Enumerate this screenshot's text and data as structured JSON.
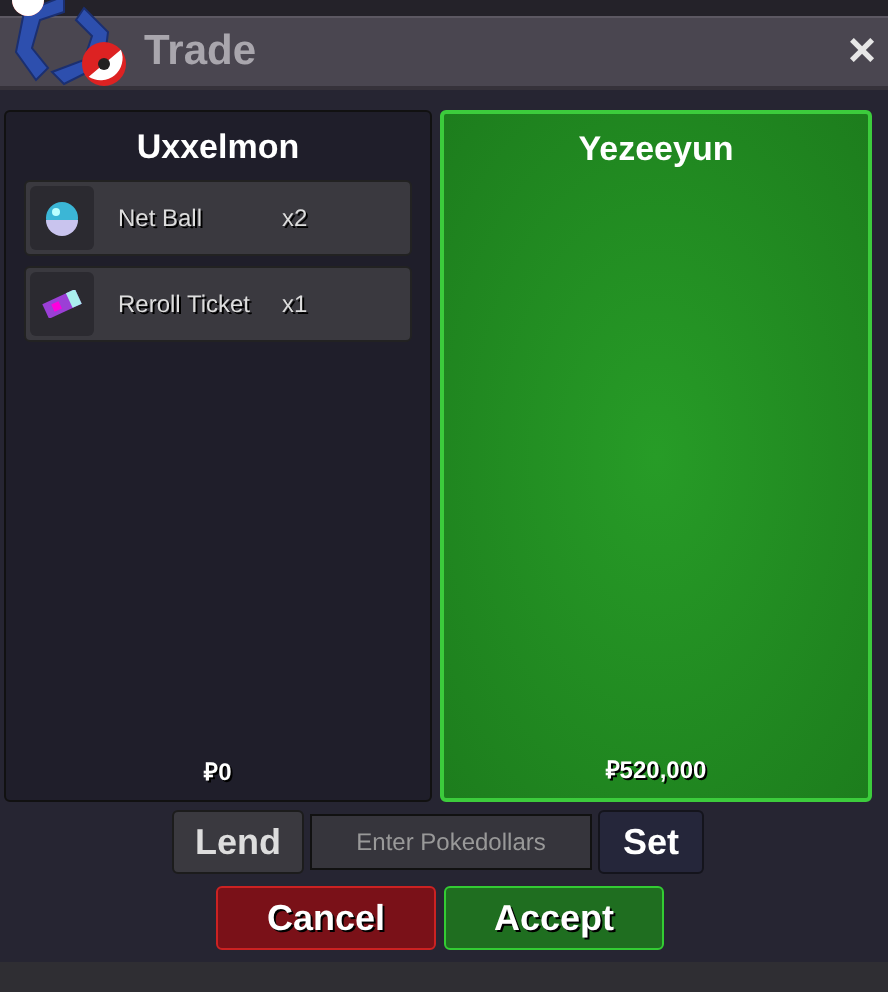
{
  "window": {
    "title": "Trade",
    "close": "×"
  },
  "panels": [
    {
      "name": "Uxxelmon",
      "ready": false,
      "money": "₽0",
      "items": [
        {
          "kind": "ball",
          "name": "Net Ball",
          "count": "x2"
        },
        {
          "kind": "ticket",
          "name": "Reroll Ticket",
          "count": "x1"
        }
      ]
    },
    {
      "name": "Yezeeyun",
      "ready": true,
      "money": "₽520,000"
    }
  ],
  "money_input": {
    "lend": "Lend",
    "placeholder": "Enter Pokedollars",
    "set": "Set"
  },
  "buttons": [
    {
      "kind": "cancel",
      "label": "Cancel"
    },
    {
      "kind": "accept",
      "label": "Accept"
    }
  ]
}
